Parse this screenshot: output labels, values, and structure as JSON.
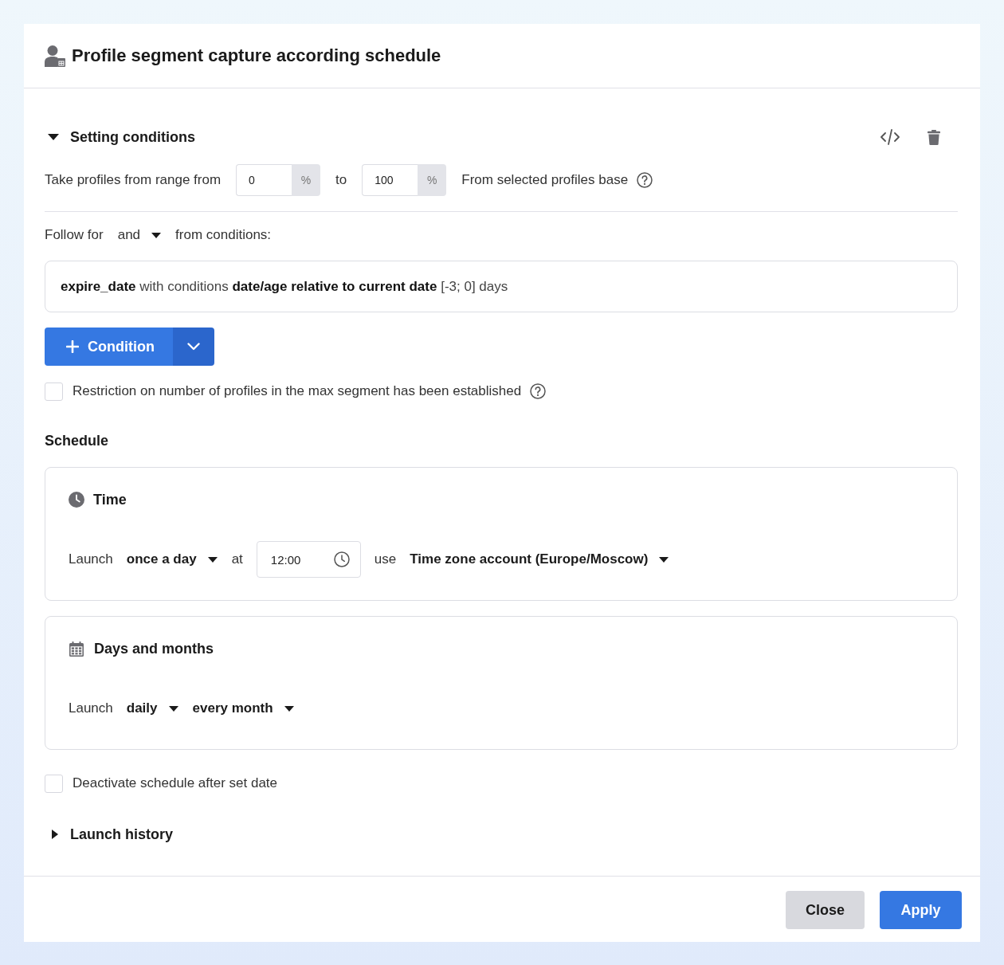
{
  "dialog": {
    "title": "Profile segment capture according schedule"
  },
  "conditions_section": {
    "title": "Setting conditions",
    "expanded": true,
    "range": {
      "label": "Take profiles from range from",
      "from": {
        "value": "0",
        "unit": "%"
      },
      "separator": "to",
      "to": {
        "value": "100",
        "unit": "%"
      },
      "suffix": "From selected profiles base"
    },
    "follow": {
      "label": "Follow for",
      "operator": "and",
      "suffix": "from conditions:"
    },
    "conditions": [
      "**expire_date** with conditions **date/age relative to current date** [-3; 0] days"
    ],
    "add_button": {
      "label": "Condition"
    },
    "restriction": {
      "label": "Restriction on number of profiles in the max segment has been established",
      "checked": false
    }
  },
  "schedule": {
    "title": "Schedule",
    "cards": [
      {
        "kind": "time",
        "title": "Time",
        "row": [
          {
            "kind": "label",
            "text": "Launch"
          },
          {
            "kind": "select",
            "text": "once a day"
          },
          {
            "kind": "label",
            "text": "at"
          },
          {
            "kind": "time",
            "text": "12:00"
          },
          {
            "kind": "label",
            "text": "use"
          },
          {
            "kind": "select",
            "text": "Time zone account (Europe/Moscow)"
          }
        ]
      },
      {
        "kind": "days",
        "title": "Days and months",
        "row": [
          {
            "kind": "label",
            "text": "Launch"
          },
          {
            "kind": "select",
            "text": "daily"
          },
          {
            "kind": "select",
            "text": "every month"
          }
        ]
      }
    ]
  },
  "deactivate": {
    "label": "Deactivate schedule after set date",
    "checked": false
  },
  "history": {
    "title": "Launch history",
    "expanded": false
  },
  "buttons": [
    {
      "kind": "secondary",
      "label": "Close"
    },
    {
      "kind": "primary",
      "label": "Apply"
    }
  ]
}
